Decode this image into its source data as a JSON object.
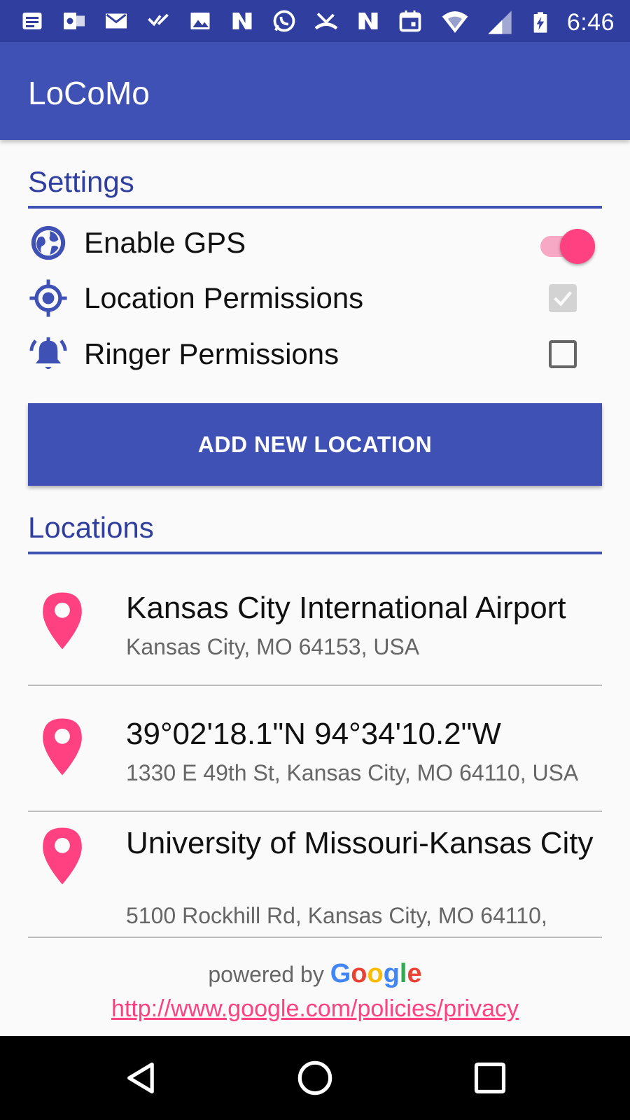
{
  "status_bar": {
    "time": "6:46",
    "left_icons": [
      "notes-icon",
      "outlook-icon",
      "gmail-icon",
      "tasks-icon",
      "gallery-icon",
      "n-app-icon",
      "whatsapp-icon",
      "missed-call-icon",
      "n-app-icon",
      "calendar-icon"
    ],
    "right_icons": [
      "wifi-icon",
      "signal-icon",
      "battery-charging-icon"
    ]
  },
  "app_bar": {
    "title": "LoCoMo"
  },
  "settings": {
    "heading": "Settings",
    "items": [
      {
        "label": "Enable GPS",
        "icon": "globe-icon",
        "control": "switch",
        "checked": true
      },
      {
        "label": "Location Permissions",
        "icon": "gps-target-icon",
        "control": "checkbox",
        "checked": true,
        "disabled": true
      },
      {
        "label": "Ringer Permissions",
        "icon": "bell-ringing-icon",
        "control": "checkbox",
        "checked": false
      }
    ]
  },
  "add_location_button": {
    "label": "ADD NEW LOCATION"
  },
  "locations": {
    "heading": "Locations",
    "items": [
      {
        "name": "Kansas City International Airport",
        "address": "Kansas City, MO 64153, USA",
        "icon": "map-pin-icon"
      },
      {
        "name": "39°02'18.1\"N 94°34'10.2\"W",
        "address": "1330 E 49th St, Kansas City, MO 64110, USA",
        "icon": "map-pin-icon"
      },
      {
        "name": "University of Missouri-Kansas City",
        "address": "5100 Rockhill Rd, Kansas City, MO 64110,",
        "icon": "map-pin-icon"
      }
    ]
  },
  "footer": {
    "powered_by": "powered by",
    "google_letters": [
      "G",
      "o",
      "o",
      "g",
      "l",
      "e"
    ],
    "privacy_link": "http://www.google.com/policies/privacy"
  },
  "nav_bar": {
    "icons": [
      "back-icon",
      "home-icon",
      "recents-icon"
    ]
  },
  "colors": {
    "primary": "#3f51b5",
    "primary_dark": "#303f9f",
    "accent": "#ff4081",
    "google": [
      "#4285F4",
      "#EA4335",
      "#FBBC05",
      "#4285F4",
      "#34A853",
      "#EA4335"
    ]
  }
}
